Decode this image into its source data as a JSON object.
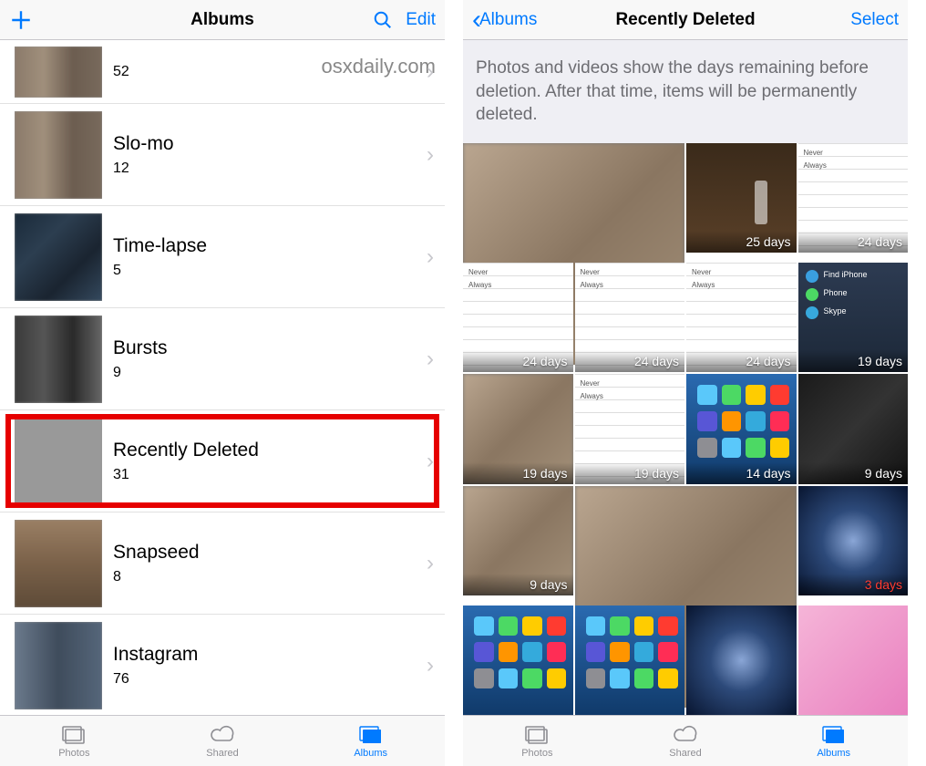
{
  "watermark": "osxdaily.com",
  "colors": {
    "accent": "#007aff",
    "highlight": "#e60000"
  },
  "left": {
    "nav": {
      "title": "Albums",
      "edit": "Edit"
    },
    "albums": [
      {
        "name": "",
        "count": "52"
      },
      {
        "name": "Slo-mo",
        "count": "12"
      },
      {
        "name": "Time-lapse",
        "count": "5"
      },
      {
        "name": "Bursts",
        "count": "9"
      },
      {
        "name": "Recently Deleted",
        "count": "31",
        "highlight": true
      },
      {
        "name": "Snapseed",
        "count": "8"
      },
      {
        "name": "Instagram",
        "count": "76"
      }
    ],
    "tabs": {
      "photos": "Photos",
      "shared": "Shared",
      "albums": "Albums",
      "active": "albums"
    }
  },
  "right": {
    "nav": {
      "back": "Albums",
      "title": "Recently Deleted",
      "select": "Select"
    },
    "banner": "Photos and videos show the days remaining before deletion. After that time, items will be permanently deleted.",
    "items": [
      {
        "span": 2,
        "style": "c-blur",
        "label": ""
      },
      {
        "span": 1,
        "style": "c-glass",
        "label": "25 days"
      },
      {
        "span": 1,
        "style": "c-settings",
        "label": "24 days"
      },
      {
        "span": 1,
        "style": "c-settings",
        "label": "24 days"
      },
      {
        "span": 1,
        "style": "c-settings",
        "label": "24 days"
      },
      {
        "span": 1,
        "style": "c-settings",
        "label": "24 days"
      },
      {
        "span": 1,
        "style": "c-contacts",
        "label": "19 days"
      },
      {
        "span": 1,
        "style": "c-blur",
        "label": "19 days"
      },
      {
        "span": 1,
        "style": "c-settings",
        "label": "19 days"
      },
      {
        "span": 1,
        "style": "c-apps",
        "label": "14 days"
      },
      {
        "span": 1,
        "style": "c-dark",
        "label": "9 days"
      },
      {
        "span": 1,
        "style": "c-blur",
        "label": "9 days"
      },
      {
        "span": 2,
        "style": "c-blur",
        "label": ""
      },
      {
        "span": 1,
        "style": "c-galaxy",
        "label": "3 days",
        "red": true
      },
      {
        "span": 1,
        "style": "c-apps",
        "label": ""
      },
      {
        "span": 1,
        "style": "c-apps",
        "label": ""
      },
      {
        "span": 1,
        "style": "c-galaxy",
        "label": ""
      },
      {
        "span": 1,
        "style": "c-keyboard",
        "label": ""
      }
    ],
    "tabs": {
      "photos": "Photos",
      "shared": "Shared",
      "albums": "Albums",
      "active": "albums"
    }
  }
}
